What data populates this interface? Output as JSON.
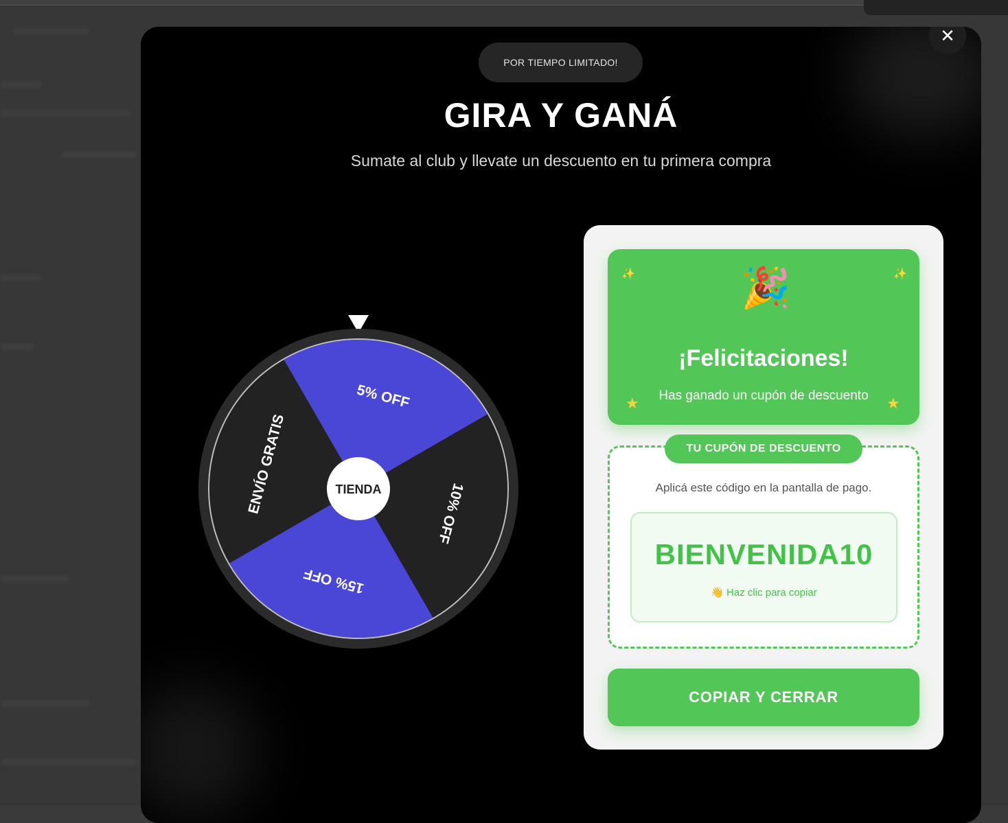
{
  "colors": {
    "accent_green": "#52c656",
    "wheel_blue": "#4b47d6",
    "wheel_dark": "#222222",
    "modal_bg": "#000000"
  },
  "modal": {
    "close_icon": "close-icon",
    "badge": "POR TIEMPO LIMITADO!",
    "title": "GIRA Y GANÁ",
    "subtitle": "Sumate al club y llevate un descuento en tu primera compra"
  },
  "wheel": {
    "center_label": "TIENDA",
    "segments": [
      {
        "label": "5% OFF",
        "color": "#4b47d6"
      },
      {
        "label": "10% OFF",
        "color": "#222222"
      },
      {
        "label": "15% OFF",
        "color": "#4b47d6"
      },
      {
        "label": "ENVÍO GRATIS",
        "color": "#222222"
      }
    ]
  },
  "result": {
    "icon": "party-popper-icon",
    "title": "¡Felicitaciones!",
    "subtitle": "Has ganado un cupón de descuento",
    "coupon_tag": "TU CUPÓN DE DESCUENTO",
    "instruction": "Aplicá este código en la pantalla de pago.",
    "code": "BIENVENIDA10",
    "copy_hint": "👋 Haz clic para copiar",
    "button": "COPIAR Y CERRAR"
  }
}
